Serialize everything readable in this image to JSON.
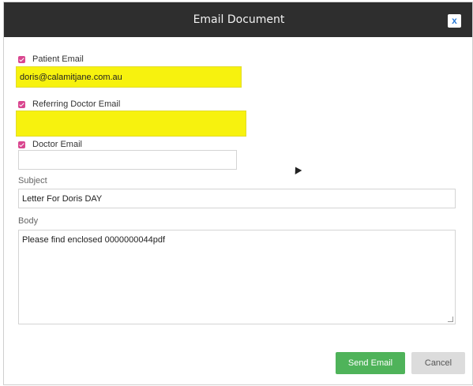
{
  "dialog": {
    "title": "Email Document",
    "close_label": "x"
  },
  "fields": {
    "patient_email": {
      "label": "Patient Email",
      "checked": true,
      "value": "doris@calamitjane.com.au"
    },
    "referring_doctor_email": {
      "label": "Referring Doctor Email",
      "checked": true,
      "value": ""
    },
    "doctor_email": {
      "label": "Doctor Email",
      "checked": true,
      "value": ""
    },
    "subject": {
      "label": "Subject",
      "value": "Letter For Doris DAY"
    },
    "body": {
      "label": "Body",
      "value": "Please find enclosed 0000000044pdf"
    }
  },
  "buttons": {
    "send_label": "Send Email",
    "cancel_label": "Cancel"
  },
  "colors": {
    "titlebar": "#2e2e2e",
    "highlight": "#f7f20e",
    "checkbox": "#d9468f",
    "send_button": "#4fb35a",
    "cancel_button": "#dcdcdc"
  }
}
